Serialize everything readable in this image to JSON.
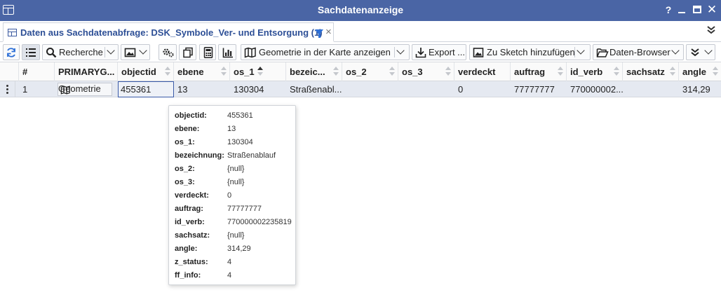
{
  "window": {
    "title": "Sachdatenanzeige",
    "help_glyph": "?",
    "close_glyph": "✕"
  },
  "tabbar": {
    "tab_label": "Daten aus Sachdatenabfrage: DSK_Symbole_Ver- und Entsorgung (1)",
    "tab_close": "×",
    "overflow_glyph": "»"
  },
  "toolbar": {
    "recherche": "Recherche",
    "geometrie": "Geometrie in der Karte anzeigen",
    "export": "Export ...",
    "sketch": "Zu Sketch hinzufügen",
    "daten_browser": "Daten-Browser"
  },
  "grid": {
    "columns": [
      "#",
      "PRIMARYG...",
      "objectid",
      "ebene",
      "os_1",
      "bezeic...",
      "os_2",
      "os_3",
      "verdeckt",
      "auftrag",
      "id_verb",
      "sachsatz",
      "angle"
    ],
    "sorted_column": "os_1",
    "rows": [
      {
        "num": "1",
        "primary": "Geometrie",
        "objectid": "455361",
        "ebene": "13",
        "os_1": "130304",
        "bezeic": "Straßenabl...",
        "os_2": "",
        "os_3": "",
        "verdeckt": "0",
        "auftrag": "77777777",
        "id_verb": "770000002...",
        "sachsatz": "",
        "angle": "314,29"
      }
    ]
  },
  "tooltip": {
    "rows": [
      {
        "k": "objectid:",
        "v": "455361"
      },
      {
        "k": "ebene:",
        "v": "13"
      },
      {
        "k": "os_1:",
        "v": "130304"
      },
      {
        "k": "bezeichnung:",
        "v": "Straßenablauf"
      },
      {
        "k": "os_2:",
        "v": "{null}"
      },
      {
        "k": "os_3:",
        "v": "{null}"
      },
      {
        "k": "verdeckt:",
        "v": "0"
      },
      {
        "k": "auftrag:",
        "v": "77777777"
      },
      {
        "k": "id_verb:",
        "v": "770000002235819"
      },
      {
        "k": "sachsatz:",
        "v": "{null}"
      },
      {
        "k": "angle:",
        "v": "314,29"
      },
      {
        "k": "z_status:",
        "v": "4"
      },
      {
        "k": "ff_info:",
        "v": "4"
      }
    ]
  },
  "colors": {
    "titlebar": "#4a65a5",
    "tab_text": "#2d4f96",
    "filter_icon": "#2d6fd6",
    "row_selected": "#e5e9f1",
    "cell_focus_border": "#3a5aa8"
  }
}
